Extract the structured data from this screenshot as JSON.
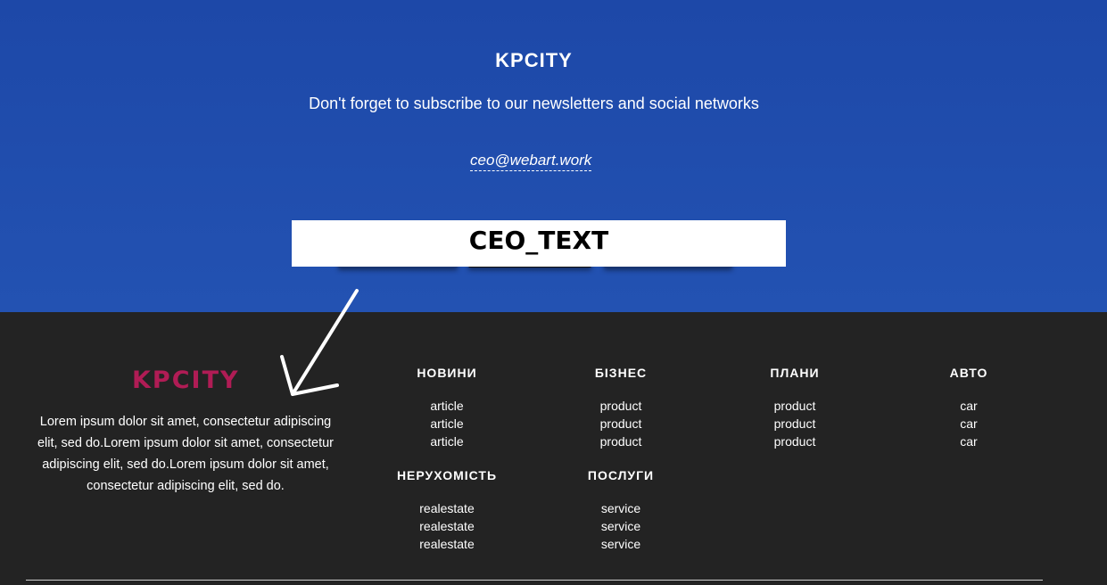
{
  "newsletter": {
    "brand": "KPCITY",
    "tagline": "Don't forget to subscribe to our newsletters and social networks",
    "email": "ceo@webart.work",
    "overlay_text": "CEO_TEXT"
  },
  "footer": {
    "brand": "KPCITY",
    "brand_color": "#b01c55",
    "description": "Lorem ipsum dolor sit amet, consectetur adipiscing elit, sed do.Lorem ipsum dolor sit amet, consectetur adipiscing elit, sed do.Lorem ipsum dolor sit amet, consectetur adipiscing elit, sed do.",
    "columns": [
      {
        "title": "НОВИНИ",
        "items": [
          "article",
          "article",
          "article"
        ]
      },
      {
        "title": "БІЗНЕС",
        "items": [
          "product",
          "product",
          "product"
        ]
      },
      {
        "title": "ПЛАНИ",
        "items": [
          "product",
          "product",
          "product"
        ]
      },
      {
        "title": "АВТО",
        "items": [
          "car",
          "car",
          "car"
        ]
      },
      {
        "title": "НЕРУХОМІСТЬ",
        "items": [
          "realestate",
          "realestate",
          "realestate"
        ]
      },
      {
        "title": "ПОСЛУГИ",
        "items": [
          "service",
          "service",
          "service"
        ]
      }
    ]
  },
  "colors": {
    "top_background": "#1d48a8",
    "footer_background": "#232323"
  }
}
